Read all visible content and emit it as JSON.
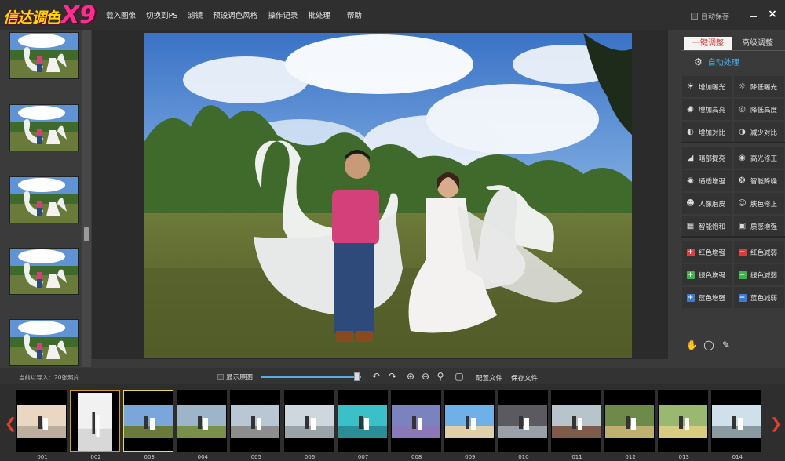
{
  "logo": {
    "cn": "信达调色",
    "x9": "X9"
  },
  "menu": [
    "载入图像",
    "切换到PS",
    "滤镜",
    "预设调色风格",
    "操作记录",
    "批处理",
    "帮助"
  ],
  "window": {
    "autosave": "自动保存",
    "close": "×"
  },
  "colors": {
    "accent": "#39b6ff",
    "tab_active_text": "#d33030",
    "red": "#e23b3b",
    "green": "#3cb44a",
    "blue": "#3a7bd5",
    "selection": "#d4a017"
  },
  "bottom_toolbar": {
    "import_count": "当前以导入：20张照片",
    "show_original": "显示原图",
    "zoom_percent": 95,
    "config_file": "配置文件",
    "save_file": "保存文件"
  },
  "right_panel": {
    "tabs": [
      "一键调整",
      "高级调整"
    ],
    "auto_process": "自动处理",
    "buttons": [
      {
        "label": "增加曝光",
        "icon": "sun-icon"
      },
      {
        "label": "降低曝光",
        "icon": "sun-dim-icon"
      },
      {
        "label": "增加高亮",
        "icon": "bulb-icon"
      },
      {
        "label": "降低高度",
        "icon": "bulb-dim-icon"
      },
      {
        "label": "增加对比",
        "icon": "contrast-icon"
      },
      {
        "label": "减少对比",
        "icon": "contrast-dim-icon"
      },
      {
        "label": "暗部提亮",
        "icon": "shadow-icon"
      },
      {
        "label": "高光修正",
        "icon": "highlight-icon"
      },
      {
        "label": "通透增强",
        "icon": "clarity-icon"
      },
      {
        "label": "智能降噪",
        "icon": "denoise-icon"
      },
      {
        "label": "人像磨皮",
        "icon": "portrait-icon"
      },
      {
        "label": "肤色修正",
        "icon": "skin-icon"
      },
      {
        "label": "智能饱和",
        "icon": "saturation-icon"
      },
      {
        "label": "质感增强",
        "icon": "texture-icon"
      },
      {
        "label": "红色增强",
        "icon": "plus-icon"
      },
      {
        "label": "红色减弱",
        "icon": "minus-icon"
      },
      {
        "label": "绿色增强",
        "icon": "plus-icon"
      },
      {
        "label": "绿色减弱",
        "icon": "minus-icon"
      },
      {
        "label": "蓝色增强",
        "icon": "plus-icon"
      },
      {
        "label": "蓝色减弱",
        "icon": "minus-icon"
      }
    ],
    "tools": [
      "hand-icon",
      "lasso-icon",
      "brush-icon"
    ]
  },
  "filmstrip": [
    "001",
    "002",
    "003",
    "004",
    "005",
    "006",
    "007",
    "008",
    "009",
    "010",
    "011",
    "012",
    "013",
    "014"
  ]
}
